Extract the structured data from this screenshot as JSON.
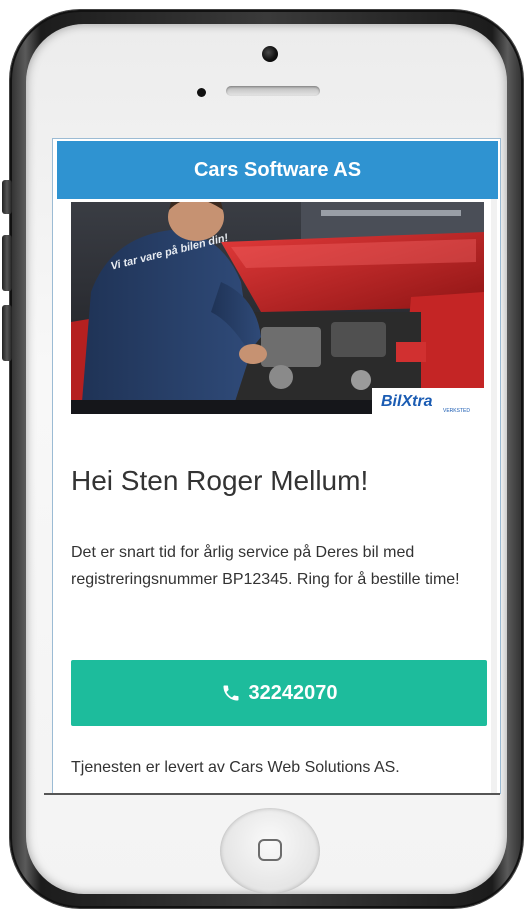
{
  "header": {
    "title": "Cars Software AS"
  },
  "hero": {
    "brand_logo_text": "BilXtra",
    "brand_logo_subtext": "VERKSTED",
    "shirt_text": "Vi tar vare på bilen din!",
    "brand_color": "#1b5cb3"
  },
  "content": {
    "greeting": "Hei Sten Roger Mellum!",
    "message": "Det er snart tid for årlig service på Deres bil med registreringsnummer BP12345. Ring for å bestille time!",
    "call_button": {
      "icon": "phone-icon",
      "number": "32242070"
    },
    "footer": "Tjenesten er levert av Cars Web Solutions AS."
  },
  "colors": {
    "header_bg": "#2f93d1",
    "button_bg": "#1dbc9c",
    "text": "#333333"
  }
}
